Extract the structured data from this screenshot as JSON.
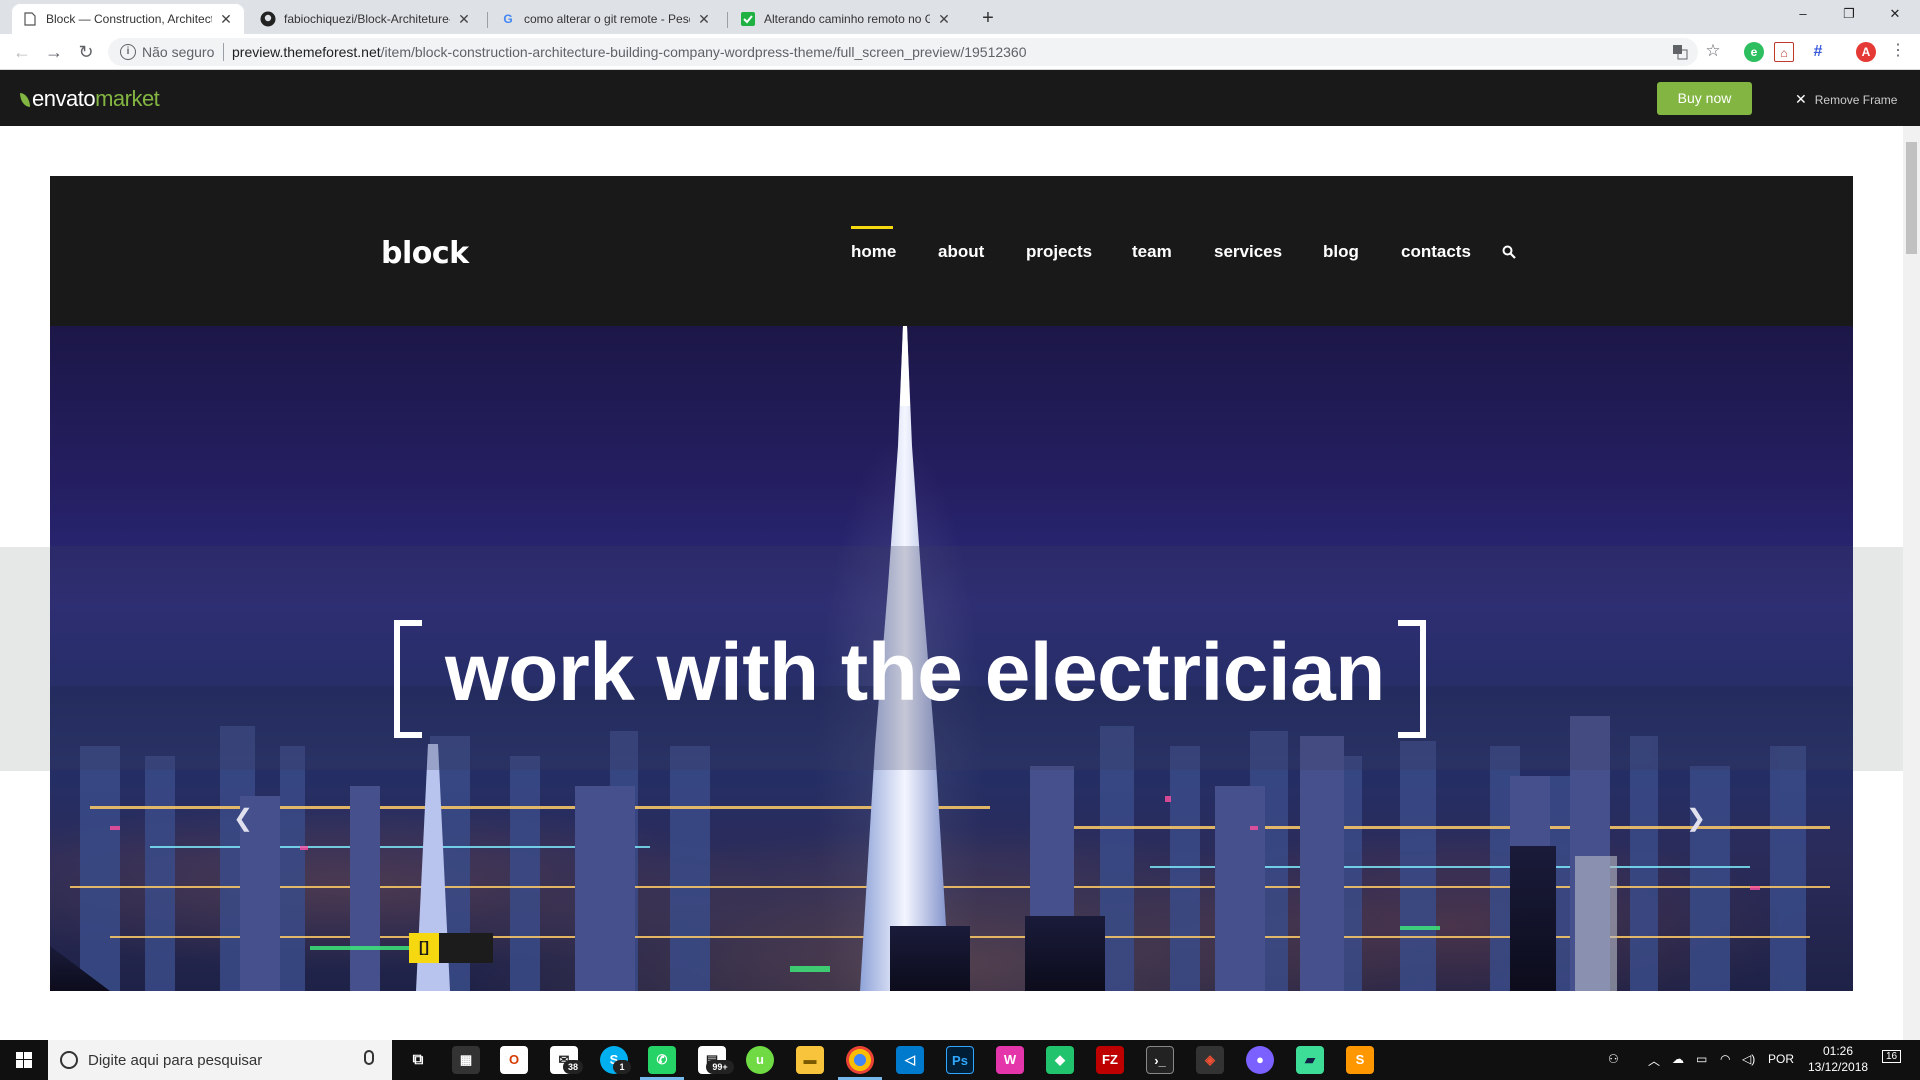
{
  "browser": {
    "tabs": [
      {
        "title": "Block — Construction, Architectu",
        "favicon": "page-icon",
        "active": true
      },
      {
        "title": "fabiochiquezi/Block-Architeture-",
        "favicon": "github-icon",
        "active": false
      },
      {
        "title": "como alterar o git remote - Pesq",
        "favicon": "google-icon",
        "active": false
      },
      {
        "title": "Alterando caminho remoto no G",
        "favicon": "green-site-icon",
        "active": false
      }
    ],
    "new_tab": "+",
    "window_controls": {
      "minimize": "–",
      "restore": "❐",
      "close": "✕"
    },
    "security_label": "Não seguro",
    "url_host": "preview.themeforest.net",
    "url_path": "/item/block-construction-architecture-building-company-wordpress-theme/full_screen_preview/19512360",
    "profile_initial": "A"
  },
  "envato_bar": {
    "logo_main": "envato",
    "logo_accent": "market",
    "buy_label": "Buy now",
    "remove_label": "Remove Frame",
    "accent_color": "#82b541"
  },
  "site": {
    "brand": "block",
    "nav": [
      {
        "label": "home",
        "active": true
      },
      {
        "label": "about",
        "active": false
      },
      {
        "label": "projects",
        "active": false
      },
      {
        "label": "team",
        "active": false
      },
      {
        "label": "services",
        "active": false
      },
      {
        "label": "blog",
        "active": false
      },
      {
        "label": "contacts",
        "active": false
      }
    ],
    "accent_color": "#f5d80f",
    "hero_title": "work with the electrician",
    "prev_arrow": "❮",
    "next_arrow": "❯",
    "slider_active_label": "[]"
  },
  "taskbar": {
    "search_placeholder": "Digite aqui para pesquisar",
    "apps": [
      {
        "name": "task-view-icon",
        "badge": ""
      },
      {
        "name": "calculator-icon",
        "badge": ""
      },
      {
        "name": "office-icon",
        "badge": ""
      },
      {
        "name": "mail-icon",
        "badge": "38"
      },
      {
        "name": "skype-icon",
        "badge": "1"
      },
      {
        "name": "whatsapp-icon",
        "badge": ""
      },
      {
        "name": "calendar-icon",
        "badge": "99+"
      },
      {
        "name": "upwork-icon",
        "badge": ""
      },
      {
        "name": "file-explorer-icon",
        "badge": ""
      },
      {
        "name": "chrome-icon",
        "badge": ""
      },
      {
        "name": "vscode-icon",
        "badge": ""
      },
      {
        "name": "photoshop-icon",
        "badge": ""
      },
      {
        "name": "webstorm-icon",
        "badge": ""
      },
      {
        "name": "app-green-icon",
        "badge": ""
      },
      {
        "name": "filezilla-icon",
        "badge": ""
      },
      {
        "name": "terminal-icon",
        "badge": ""
      },
      {
        "name": "git-icon",
        "badge": ""
      },
      {
        "name": "purple-app-icon",
        "badge": ""
      },
      {
        "name": "notes-icon",
        "badge": ""
      },
      {
        "name": "sublime-icon",
        "badge": ""
      }
    ],
    "language": "POR",
    "time": "01:26",
    "date": "13/12/2018",
    "notifications": "16"
  }
}
